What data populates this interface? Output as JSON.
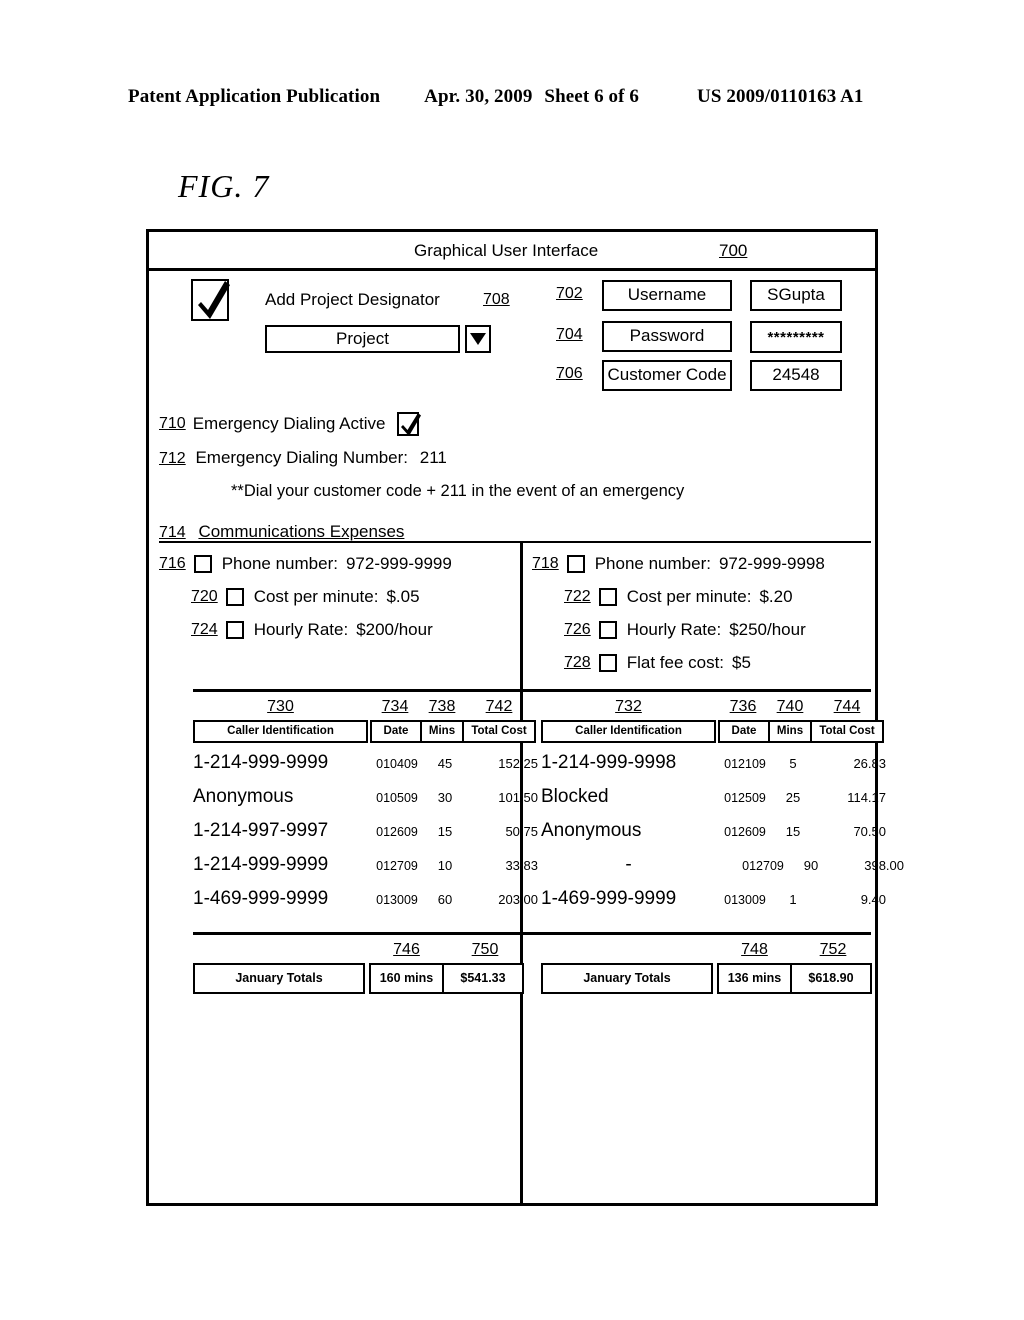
{
  "page_header": {
    "publication": "Patent Application Publication",
    "date": "Apr. 30, 2009",
    "sheet": "Sheet 6 of 6",
    "patent_number": "US 2009/0110163 A1"
  },
  "figure": {
    "label": "FIG. 7"
  },
  "gui": {
    "title": "Graphical User Interface",
    "title_ref": "700",
    "designator": {
      "checkbox_checked": true,
      "label": "Add Project Designator",
      "ref": "708",
      "project_value": "Project",
      "dropdown_icon": "chevron-down-icon"
    },
    "credentials": [
      {
        "ref": "702",
        "label": "Username",
        "value": "SGupta"
      },
      {
        "ref": "704",
        "label": "Password",
        "value": "*********"
      },
      {
        "ref": "706",
        "label": "Customer Code",
        "value": "24548"
      }
    ],
    "emergency": {
      "active_ref": "710",
      "active_label": "Emergency Dialing Active",
      "active_checked": true,
      "number_ref": "712",
      "number_label": "Emergency Dialing Number:",
      "number_value": "211",
      "note": "**Dial your customer code + 211 in the event of an emergency"
    },
    "communications": {
      "ref": "714",
      "heading": "Communications Expenses",
      "lines_left": [
        {
          "ref": "716",
          "label": "Phone number:",
          "value": "972-999-9999",
          "checked": false
        },
        {
          "ref": "720",
          "label": "Cost per minute:",
          "value": "$.05",
          "checked": false
        },
        {
          "ref": "724",
          "label": "Hourly Rate:",
          "value": "$200/hour",
          "checked": false
        }
      ],
      "lines_right": [
        {
          "ref": "718",
          "label": "Phone number:",
          "value": "972-999-9998",
          "checked": false
        },
        {
          "ref": "722",
          "label": "Cost per minute:",
          "value": "$.20",
          "checked": false
        },
        {
          "ref": "726",
          "label": "Hourly Rate:",
          "value": "$250/hour",
          "checked": false
        },
        {
          "ref": "728",
          "label": "Flat fee cost:",
          "value": "$5",
          "checked": false
        }
      ]
    },
    "table_left": {
      "column_refs": [
        "730",
        "734",
        "738",
        "742"
      ],
      "headers": [
        "Caller Identification",
        "Date",
        "Mins",
        "Total Cost"
      ],
      "rows": [
        [
          "1-214-999-9999",
          "010409",
          "45",
          "152.25"
        ],
        [
          "Anonymous",
          "010509",
          "30",
          "101.50"
        ],
        [
          "1-214-997-9997",
          "012609",
          "15",
          "50.75"
        ],
        [
          "1-214-999-9999",
          "012709",
          "10",
          "33.83"
        ],
        [
          "1-469-999-9999",
          "013009",
          "60",
          "203.00"
        ]
      ],
      "totals": {
        "refs": [
          "746",
          "750"
        ],
        "label": "January Totals",
        "mins": "160 mins",
        "cost": "$541.33"
      }
    },
    "table_right": {
      "column_refs": [
        "732",
        "736",
        "740",
        "744"
      ],
      "headers": [
        "Caller Identification",
        "Date",
        "Mins",
        "Total Cost"
      ],
      "rows": [
        [
          "1-214-999-9998",
          "012109",
          "5",
          "26.83"
        ],
        [
          "Blocked",
          "012509",
          "25",
          "114.17"
        ],
        [
          "Anonymous",
          "012609",
          "15",
          "70.50"
        ],
        [
          "-",
          "012709",
          "90",
          "398.00"
        ],
        [
          "1-469-999-9999",
          "013009",
          "1",
          "9.40"
        ]
      ],
      "totals": {
        "refs": [
          "748",
          "752"
        ],
        "label": "January Totals",
        "mins": "136 mins",
        "cost": "$618.90"
      }
    }
  }
}
